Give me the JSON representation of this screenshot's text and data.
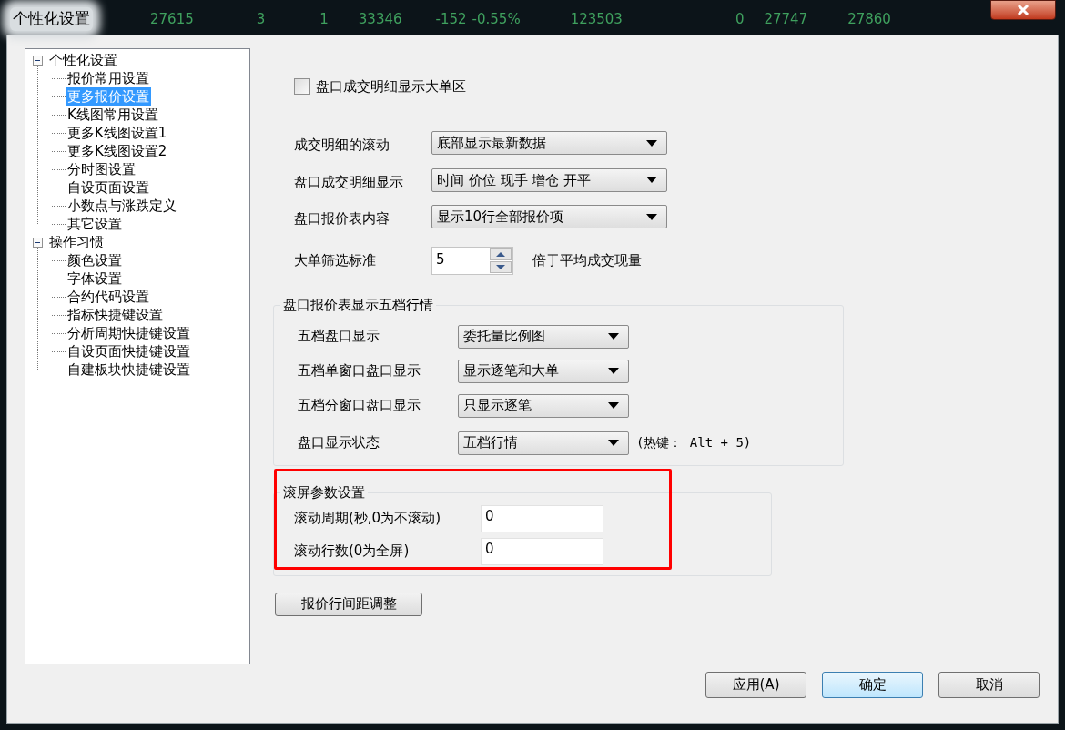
{
  "window": {
    "title": "个性化设置",
    "background_ticker": [
      "27615",
      "3",
      "1",
      "33346",
      "-152",
      "-0.55%",
      "123503",
      "0",
      "27747",
      "27860"
    ]
  },
  "tree": [
    {
      "label": "个性化设置",
      "expanded": true,
      "selected": false,
      "children": [
        {
          "label": "报价常用设置",
          "selected": false
        },
        {
          "label": "更多报价设置",
          "selected": true
        },
        {
          "label": "K线图常用设置",
          "selected": false
        },
        {
          "label": "更多K线图设置1",
          "selected": false
        },
        {
          "label": "更多K线图设置2",
          "selected": false
        },
        {
          "label": "分时图设置",
          "selected": false
        },
        {
          "label": "自设页面设置",
          "selected": false
        },
        {
          "label": "小数点与涨跌定义",
          "selected": false
        },
        {
          "label": "其它设置",
          "selected": false
        }
      ]
    },
    {
      "label": "操作习惯",
      "expanded": true,
      "selected": false,
      "children": [
        {
          "label": "颜色设置",
          "selected": false
        },
        {
          "label": "字体设置",
          "selected": false
        },
        {
          "label": "合约代码设置",
          "selected": false
        },
        {
          "label": "指标快捷键设置",
          "selected": false
        },
        {
          "label": "分析周期快捷键设置",
          "selected": false
        },
        {
          "label": "自设页面快捷键设置",
          "selected": false
        },
        {
          "label": "自建板块快捷键设置",
          "selected": false
        }
      ]
    }
  ],
  "checkbox": {
    "label": "盘口成交明细显示大单区",
    "checked": false
  },
  "combos": [
    {
      "label": "成交明细的滚动",
      "value": "底部显示最新数据"
    },
    {
      "label": "盘口成交明细显示",
      "value": "时间 价位 现手 增仓 开平"
    },
    {
      "label": "盘口报价表内容",
      "value": "显示10行全部报价项"
    }
  ],
  "spin": {
    "label": "大单筛选标准",
    "value": "5",
    "suffix": "倍于平均成交现量"
  },
  "five_level_group": {
    "title": "盘口报价表显示五档行情",
    "combos": [
      {
        "label": "五档盘口显示",
        "value": "委托量比例图"
      },
      {
        "label": "五档单窗口盘口显示",
        "value": "显示逐笔和大单"
      },
      {
        "label": "五档分窗口盘口显示",
        "value": "只显示逐笔"
      },
      {
        "label": "盘口显示状态",
        "value": "五档行情",
        "hint": "(热键： Alt + 5)"
      }
    ]
  },
  "scroll_group": {
    "title": "滚屏参数设置",
    "fields": [
      {
        "label": "滚动周期(秒,0为不滚动)",
        "value": "0"
      },
      {
        "label": "滚动行数(0为全屏)",
        "value": "0"
      }
    ]
  },
  "spacing_button": "报价行间距调整",
  "buttons": [
    {
      "label": "应用(A)",
      "default": false
    },
    {
      "label": "确定",
      "default": true
    },
    {
      "label": "取消",
      "default": false
    }
  ]
}
